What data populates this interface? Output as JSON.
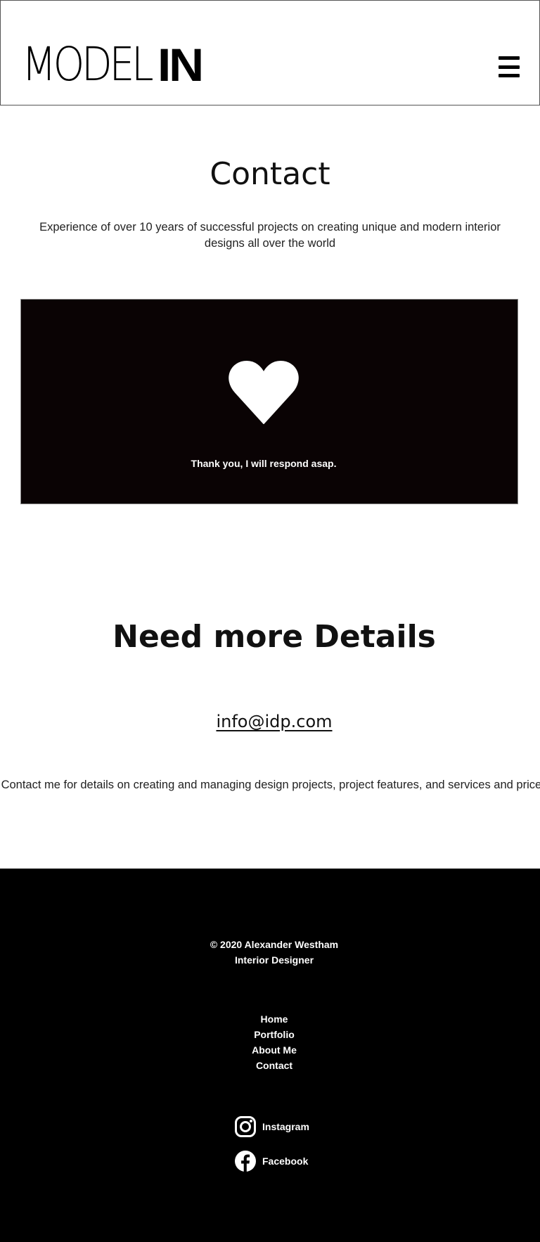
{
  "header": {
    "logo_thin": "MODEL",
    "logo_bold": "IN",
    "menu_icon": "hamburger-menu-icon"
  },
  "contact": {
    "title": "Contact",
    "subtitle": "Experience of over 10 years of successful projects on creating unique and modern interior designs all over the world"
  },
  "confirmation": {
    "icon": "heart-icon",
    "message": "Thank you, I will respond asap.",
    "background": "#0a0304"
  },
  "details": {
    "title": "Need more Details",
    "email": "info@idp.com",
    "text": "Contact me for details on creating and managing design projects, project features, and services and prices"
  },
  "footer": {
    "copyright": "© 2020 Alexander Westham",
    "role": "Interior Designer",
    "nav": [
      "Home",
      "Portfolio",
      "About Me",
      "Contact"
    ],
    "social": [
      {
        "icon": "instagram-icon",
        "label": "Instagram"
      },
      {
        "icon": "facebook-icon",
        "label": "Facebook"
      }
    ],
    "background": "#000000"
  }
}
